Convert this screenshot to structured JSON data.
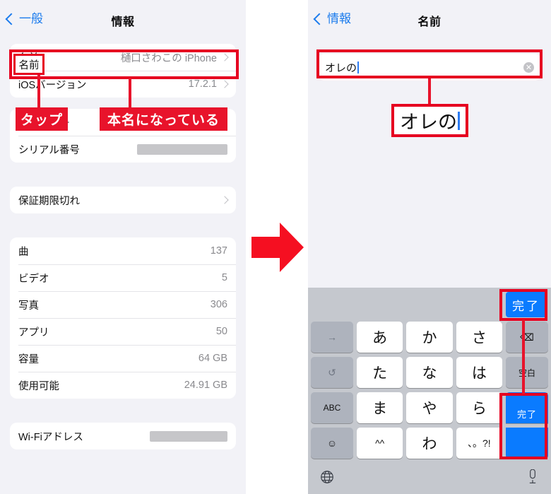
{
  "left_screen": {
    "nav": {
      "back_label": "一般",
      "back_icon": "chevron-left-icon",
      "title": "情報"
    },
    "group1": [
      {
        "label": "名前",
        "value": "樋口さわこの iPhone",
        "chevron": true
      },
      {
        "label": "iOSバージョン",
        "value": "17.2.1",
        "chevron": true
      }
    ],
    "group2": [
      {
        "label": "モデル番号",
        "value": "",
        "redacted": true,
        "redact_width": 72
      },
      {
        "label": "シリアル番号",
        "value": "",
        "redacted": true,
        "redact_width": 128
      }
    ],
    "group3": [
      {
        "label": "保証期限切れ",
        "value": "",
        "chevron": true
      }
    ],
    "group4": [
      {
        "label": "曲",
        "value": "137"
      },
      {
        "label": "ビデオ",
        "value": "5"
      },
      {
        "label": "写真",
        "value": "306"
      },
      {
        "label": "アプリ",
        "value": "50"
      },
      {
        "label": "容量",
        "value": "64 GB"
      },
      {
        "label": "使用可能",
        "value": "24.91 GB"
      }
    ],
    "group5": [
      {
        "label": "Wi-Fiアドレス",
        "value": "",
        "redacted": true,
        "redact_width": 110
      }
    ]
  },
  "right_screen": {
    "nav": {
      "back_label": "情報",
      "back_icon": "chevron-left-icon",
      "title": "名前"
    },
    "name_field": {
      "value": "オレの",
      "clear_icon": "clear-circle-icon",
      "caret": true
    },
    "keyboard": {
      "toolbar_done": "完了",
      "rows": [
        [
          {
            "label": "→",
            "type": "fn"
          },
          {
            "label": "あ",
            "type": "char"
          },
          {
            "label": "か",
            "type": "char"
          },
          {
            "label": "さ",
            "type": "char"
          },
          {
            "label": "⌫",
            "type": "fn",
            "icon": "backspace-icon"
          }
        ],
        [
          {
            "label": "↺",
            "type": "fn"
          },
          {
            "label": "た",
            "type": "char"
          },
          {
            "label": "な",
            "type": "char"
          },
          {
            "label": "は",
            "type": "char"
          },
          {
            "label": "空白",
            "type": "fn-text"
          }
        ],
        [
          {
            "label": "ABC",
            "type": "fn-text"
          },
          {
            "label": "ま",
            "type": "char"
          },
          {
            "label": "や",
            "type": "char"
          },
          {
            "label": "ら",
            "type": "char"
          },
          {
            "label": "完了",
            "type": "blue"
          }
        ],
        [
          {
            "label": "☺",
            "type": "fn",
            "icon": "emoji-icon"
          },
          {
            "label": "^^",
            "type": "char"
          },
          {
            "label": "わ",
            "type": "char"
          },
          {
            "label": "、。?!",
            "type": "char"
          },
          {
            "label": "",
            "type": "blue-cont"
          }
        ]
      ],
      "bottom": {
        "globe_icon": "globe-icon",
        "mic_icon": "microphone-icon"
      }
    }
  },
  "annotations": {
    "tap_label": "タップ",
    "real_name_label": "本名になっている",
    "callout_text": "オレの",
    "arrow_icon": "right-arrow-icon",
    "accent_color": "#e8132b",
    "outline_color": "#e60020"
  }
}
